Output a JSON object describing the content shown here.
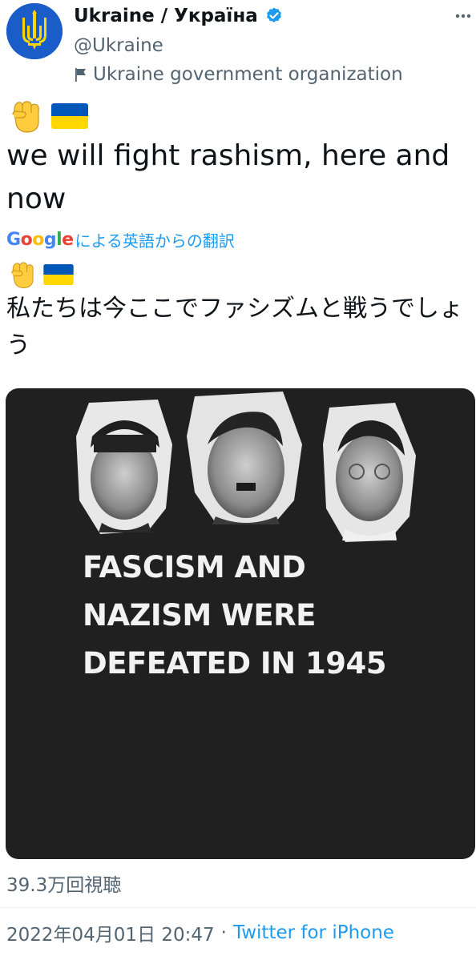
{
  "author": {
    "display_name": "Ukraine / Україна",
    "handle": "@Ukraine",
    "label": "Ukraine government organization"
  },
  "tweet": {
    "text": "we will fight rashism, here and now",
    "translation_provider": "Google",
    "translation_label": "による英語からの翻訳",
    "translated_text": "私たちは今ここでファシズムと戦うでしょう"
  },
  "media": {
    "caption_lines": "FASCISM AND\nNAZISM WERE\nDEFEATED IN 1945"
  },
  "stats": {
    "views": "39.3万回視聴"
  },
  "meta": {
    "timestamp": "2022年04月01日 20:47",
    "separator": "·",
    "source": "Twitter for iPhone"
  },
  "icons": {
    "avatar": "ukraine-trident-icon",
    "verified": "verified-badge-icon",
    "org_label": "flag-icon",
    "more": "more-icon",
    "emoji_1": "raised-fist-emoji",
    "emoji_2": "ukraine-flag-emoji"
  },
  "colors": {
    "link": "#1d9bf0",
    "secondary_text": "#536471",
    "ukraine_blue": "#0057b7",
    "ukraine_yellow": "#ffd700",
    "google_blue": "#4285f4",
    "google_red": "#ea4335",
    "google_yellow": "#fbbc05",
    "google_green": "#34a853"
  }
}
